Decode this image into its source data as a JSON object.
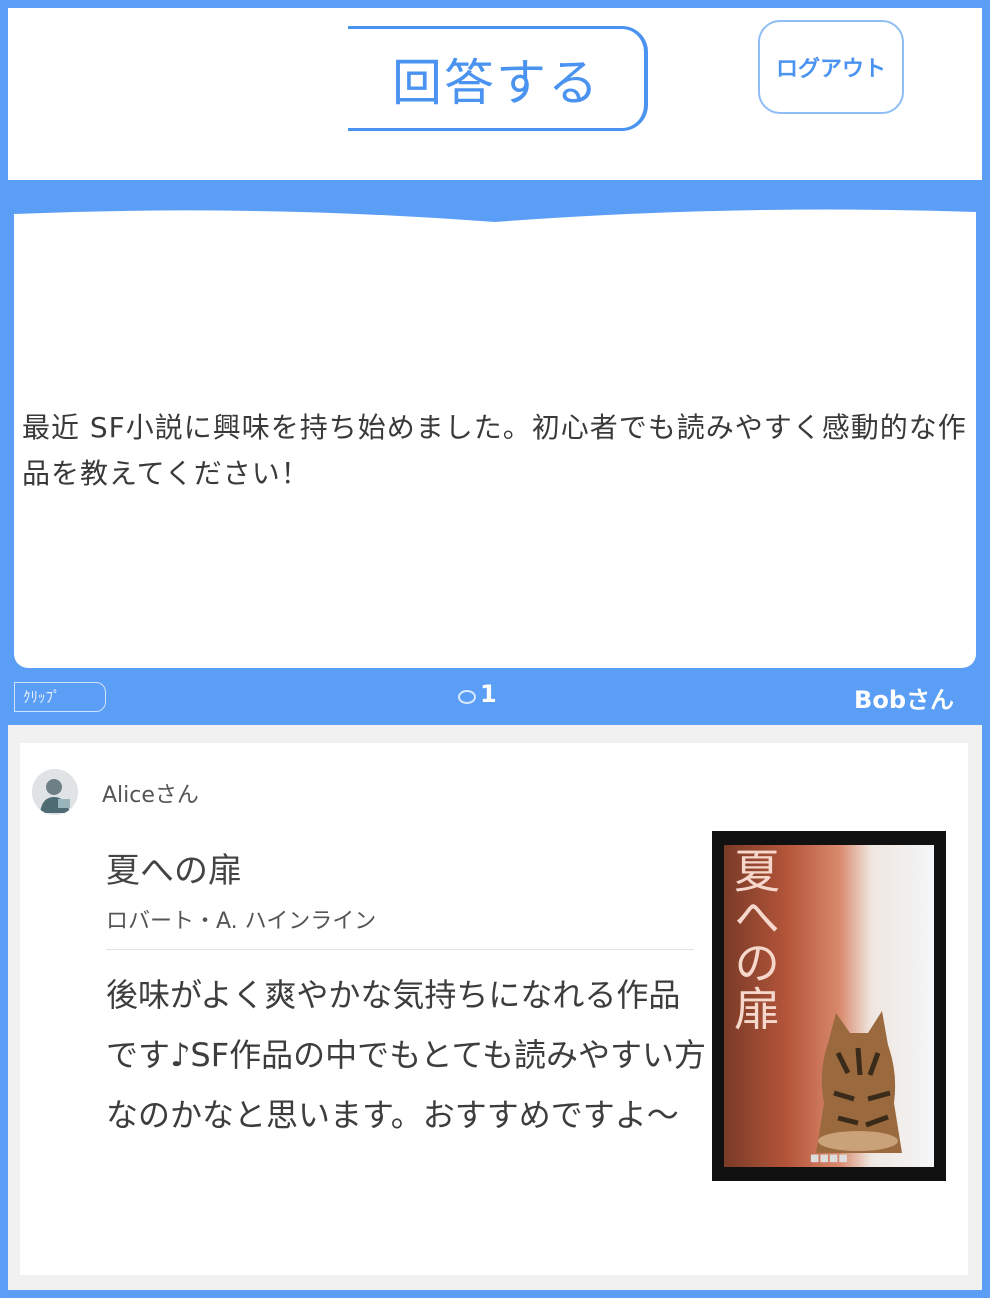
{
  "header": {
    "answer_button": "回答する",
    "logout_button": "ログアウト"
  },
  "question": {
    "text": "最近 SF小説に興味を持ち始めました。初心者でも読みやすく感動的な作品を教えてください！",
    "clip_label": "ｸﾘｯﾌﾟ",
    "answer_count": "1",
    "asker": "Bobさん"
  },
  "answer": {
    "answerer": "Aliceさん",
    "book_title": "夏への扉",
    "book_author": "ロバート・A. ハインライン",
    "text": "後味がよく爽やかな気持ちになれる作品です♪SF作品の中でもとても読みやすい方なのかなと思います。おすすめですよ〜",
    "cover": {
      "title": "夏への扉",
      "author": "ロバート・A・ハインライン"
    }
  },
  "colors": {
    "accent": "#5b9ef6",
    "accent_text": "#4a93f0"
  }
}
